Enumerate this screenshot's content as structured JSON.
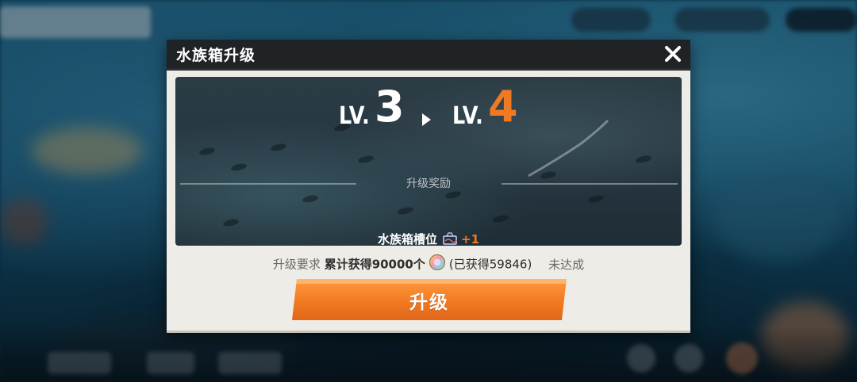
{
  "dialog": {
    "title": "水族箱升级",
    "close_icon": "close-icon"
  },
  "level": {
    "current_prefix": "LV.",
    "current_value": "3",
    "next_prefix": "LV.",
    "next_value": "4",
    "arrow_icon": "play-arrow-icon"
  },
  "rewards": {
    "title": "升级奖励",
    "items": [
      {
        "label": "水族箱槽位",
        "icon": "aquarium-slot-icon",
        "amount": "+1"
      }
    ]
  },
  "requirement": {
    "label": "升级要求",
    "text": "累计获得90000个",
    "currency_icon": "rainbow-shell-coin-icon",
    "progress": "(已获得59846)",
    "status": "未达成"
  },
  "upgrade_button": {
    "label": "升级"
  },
  "colors": {
    "accent": "#f07a24",
    "header_bg": "#202326",
    "panel_bg": "#eeece6"
  }
}
